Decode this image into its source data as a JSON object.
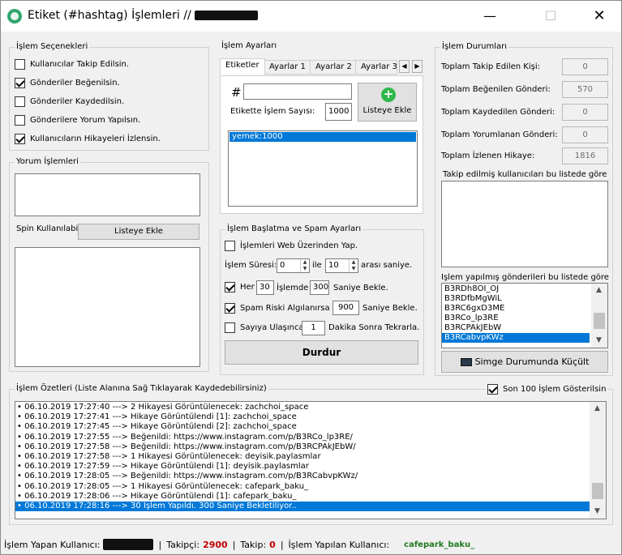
{
  "window": {
    "title": "Etiket (#hashtag) İşlemleri //",
    "minimize_glyph": "—",
    "maximize_glyph": "☐",
    "close_glyph": "✕"
  },
  "islem_secenekleri": {
    "legend": "İşlem Seçenekleri",
    "options": [
      {
        "label": "Kullanıcılar Takip Edilsin.",
        "checked": false
      },
      {
        "label": "Gönderiler Beğenilsin.",
        "checked": true
      },
      {
        "label": "Gönderiler Kaydedilsin.",
        "checked": false
      },
      {
        "label": "Gönderilere Yorum Yapılsın.",
        "checked": false
      },
      {
        "label": "Kullanıcıların Hikayeleri İzlensin.",
        "checked": true
      }
    ]
  },
  "yorum_islemleri": {
    "legend": "Yorum İşlemleri",
    "spin_label": "Spin Kullanılabilir.",
    "add_button": "Listeye Ekle"
  },
  "islem_ayarlari": {
    "legend": "İşlem Ayarları",
    "tabs": [
      "Etiketler",
      "Ayarlar 1",
      "Ayarlar 2",
      "Ayarlar 3"
    ],
    "hash": "#",
    "tag_input": "",
    "count_label": "Etikette İşlem Sayısı:",
    "count_value": "1000",
    "add_button": "Listeye Ekle",
    "tag_list": [
      "yemek:1000"
    ]
  },
  "baslatma": {
    "legend": "İşlem Başlatma ve Spam Ayarları",
    "web_label": "İşlemleri Web Üzerinden Yap.",
    "web_checked": false,
    "sure_label": "İşlem Süresi:",
    "sure_min": "0",
    "ile": "ile",
    "sure_max": "10",
    "arasi": "arası saniye.",
    "her_label": "Her",
    "her_checked": true,
    "her_value": "30",
    "islemde": "İşlemde",
    "islemde_value": "300",
    "saniye_bekle": "Saniye Bekle.",
    "spam_label": "Spam Riski Algılanırsa",
    "spam_checked": true,
    "spam_value": "900",
    "spam_suffix": "Saniye Bekle.",
    "sayi_label": "Sayıya Ulaşınca",
    "sayi_checked": false,
    "sayi_value": "1",
    "sayi_suffix": "Dakika Sonra Tekrarla.",
    "stop_button": "Durdur"
  },
  "durumlar": {
    "legend": "İşlem Durumları",
    "stats": [
      {
        "label": "Toplam Takip Edilen Kişi:",
        "value": "0"
      },
      {
        "label": "Toplam Beğenilen Gönderi:",
        "value": "570"
      },
      {
        "label": "Toplam Kaydedilen Gönderi:",
        "value": "0"
      },
      {
        "label": "Toplam Yorumlanan Gönderi:",
        "value": "0"
      },
      {
        "label": "Toplam İzlenen Hikaye:",
        "value": "1816"
      }
    ],
    "followed_list_label": "Takip edilmiş kullanıcıları bu listede göre",
    "posts_list_label": "İşlem yapılmış gönderileri bu listede göre",
    "posts": [
      "B3RDh8OI_OJ",
      "B3RDfbMgWiL",
      "B3RC6gxD3ME",
      "B3RCo_lp3RE",
      "B3RCPAkJEbW",
      "B3RCabvpKWz"
    ],
    "selected_post": 5,
    "minimize_button": "Simge Durumunda Küçült"
  },
  "ozetler": {
    "legend": "İşlem Özetleri (Liste Alanına Sağ Tıklayarak Kaydedebilirsiniz)",
    "show_last_label": "Son 100 İşlem Gösterilsin",
    "show_last_checked": true,
    "log": [
      "• 06.10.2019 17:27:40 ---> 2 Hikayesi Görüntülenecek: zachchoi_space",
      "• 06.10.2019 17:27:41 ---> Hikaye Görüntülendi [1]: zachchoi_space",
      "• 06.10.2019 17:27:45 ---> Hikaye Görüntülendi [2]: zachchoi_space",
      "• 06.10.2019 17:27:55 ---> Beğenildi: https://www.instagram.com/p/B3RCo_lp3RE/",
      "• 06.10.2019 17:27:58 ---> Beğenildi: https://www.instagram.com/p/B3RCPAkJEbW/",
      "• 06.10.2019 17:27:58 ---> 1 Hikayesi Görüntülenecek: deyisik.paylasmlar",
      "• 06.10.2019 17:27:59 ---> Hikaye Görüntülendi [1]: deyisik.paylasmlar",
      "• 06.10.2019 17:28:05 ---> Beğenildi: https://www.instagram.com/p/B3RCabvpKWz/",
      "• 06.10.2019 17:28:05 ---> 1 Hikayesi Görüntülenecek: cafepark_baku_",
      "• 06.10.2019 17:28:06 ---> Hikaye Görüntülendi [1]: cafepark_baku_",
      "• 06.10.2019 17:28:16 ---> 30 İşlem Yapıldı. 300 Saniye Bekletiliyor.."
    ],
    "selected_log": 10
  },
  "statusbar": {
    "user_label": "İşlem Yapan Kullanıcı:",
    "takipci_label": "Takipçi:",
    "takipci_value": "2900",
    "takip_label": "Takip:",
    "takip_value": "0",
    "current_label": "İşlem Yapılan Kullanıcı:",
    "current_value": "cafepark_baku_",
    "sep": "|"
  },
  "colors": {
    "selection": "#0078d7",
    "plus_icon": "#2eb84a",
    "takipci": "#c00000",
    "current_user": "#1f7a1f"
  }
}
